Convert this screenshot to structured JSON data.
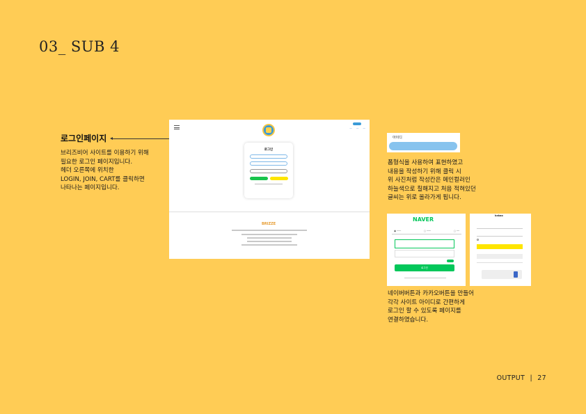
{
  "header": {
    "title": "03_ SUB 4"
  },
  "login_section": {
    "heading": "로그인페이지",
    "description": [
      "브리즈비어 사이트를 이용하기 위해",
      "필요한 로그인 페이지입니다.",
      "헤더 오른쪽에 위치한",
      "LOGIN, JOIN, CART를 클릭하면",
      "나타나는 페이지입니다."
    ]
  },
  "login_screenshot": {
    "form_title": "로그인",
    "footer_logo": "BRIZZE"
  },
  "id_field_sample": {
    "label": "아이디"
  },
  "form_desc": [
    "폼형식을 사용하여 표현하였고",
    "내용을 작성하기 위해 클릭 시",
    "위 사진처럼 작성칸은 메인컬러인",
    "하늘색으로 칠해지고 처음 적혀있던",
    "글씨는 위로 올라가게 됩니다."
  ],
  "naver_screen": {
    "logo": "NAVER",
    "login_button": "로그인"
  },
  "kakao_screen": {
    "title": "kakao"
  },
  "social_desc": [
    "네이버버튼과 카카오버튼을 만들어",
    "각각 사이트 아이디로 간편하게",
    "로그인 할 수 있도록 페이지를",
    "연결하였습니다."
  ],
  "footer": {
    "label": "OUTPUT",
    "separator": "|",
    "page": "27"
  },
  "colors": {
    "background": "#FFCC55",
    "accent": "#87C3EE",
    "naver": "#03C75A",
    "kakao": "#FEE500"
  }
}
